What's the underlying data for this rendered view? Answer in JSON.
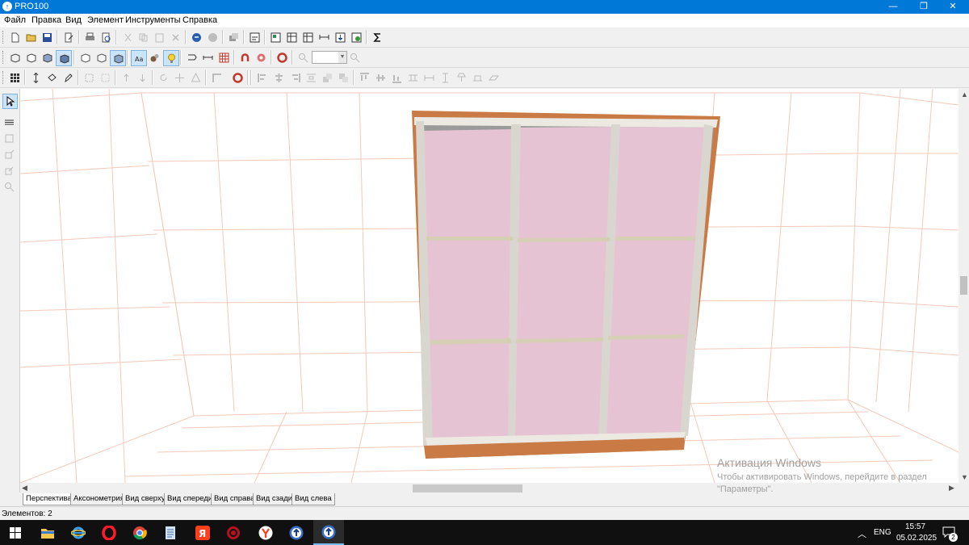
{
  "window": {
    "title": "PRO100",
    "app_icon": "pro100-logo-icon"
  },
  "title_buttons": [
    "minimize",
    "restore",
    "close"
  ],
  "menu": [
    "Файл",
    "Правка",
    "Вид",
    "Элемент",
    "Инструменты",
    "Справка"
  ],
  "tabs": [
    "Перспектива",
    "Аксонометрия",
    "Вид сверху",
    "Вид спереди",
    "Вид справа",
    "Вид сзади",
    "Вид слева"
  ],
  "active_tab": "Перспектива",
  "status": {
    "elements": "Элементов: 2"
  },
  "watermark": {
    "title": "Активация Windows",
    "line1": "Чтобы активировать Windows, перейдите в раздел",
    "line2": "\"Параметры\"."
  },
  "taskbar": {
    "apps": [
      "windows-start-icon",
      "file-explorer-icon",
      "internet-explorer-icon",
      "opera-icon",
      "chrome-icon",
      "notepad-icon",
      "yandex-icon",
      "media-icon",
      "yandex-browser-icon",
      "pro100-icon",
      "pro100-active-icon"
    ],
    "language": "ENG",
    "time": "15:57",
    "date": "05.02.2025",
    "notification_count": "2"
  },
  "colors": {
    "titlebar": "#0078d7",
    "door_panel": "#e6c3d3",
    "frame_wood": "#c97a45",
    "profile_silver": "#d8d6cf",
    "grid_lines": "#f3c9b9"
  }
}
